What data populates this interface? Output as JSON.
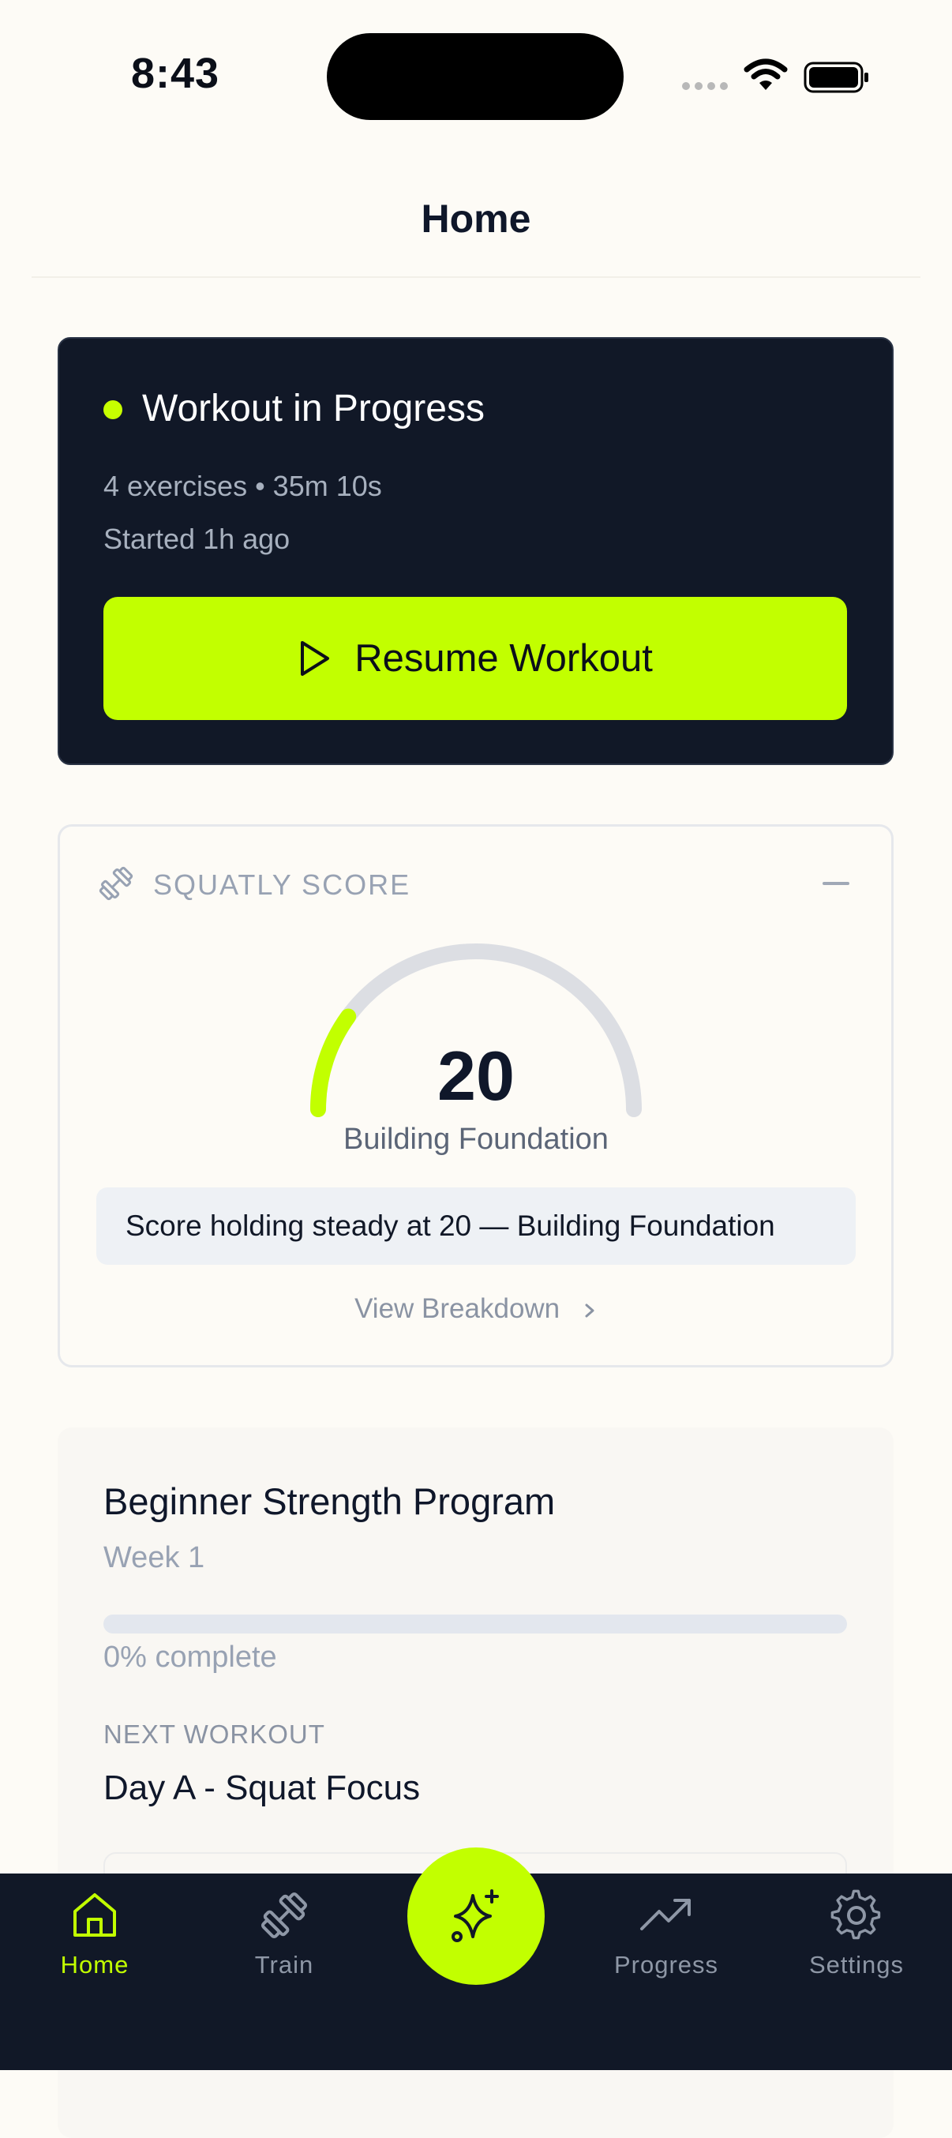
{
  "status_bar": {
    "time": "8:43"
  },
  "header": {
    "title": "Home"
  },
  "workout_card": {
    "status": "Workout in Progress",
    "meta": "4 exercises • 35m 10s",
    "started": "Started 1h ago",
    "resume_label": "Resume Workout"
  },
  "score_card": {
    "label": "SQUATLY SCORE",
    "value": "20",
    "level": "Building Foundation",
    "note": "Score holding steady at 20 — Building Foundation",
    "breakdown_label": "View Breakdown",
    "gauge_fraction": 0.2
  },
  "program": {
    "title": "Beginner Strength Program",
    "week": "Week 1",
    "progress_text": "0% complete",
    "progress_fraction": 0,
    "next_label": "NEXT WORKOUT",
    "next_name": "Day A - Squat Focus"
  },
  "tabs": {
    "home": "Home",
    "train": "Train",
    "progress": "Progress",
    "settings": "Settings"
  },
  "colors": {
    "accent": "#C2FF00",
    "dark": "#111827",
    "muted": "#98A2B3"
  }
}
